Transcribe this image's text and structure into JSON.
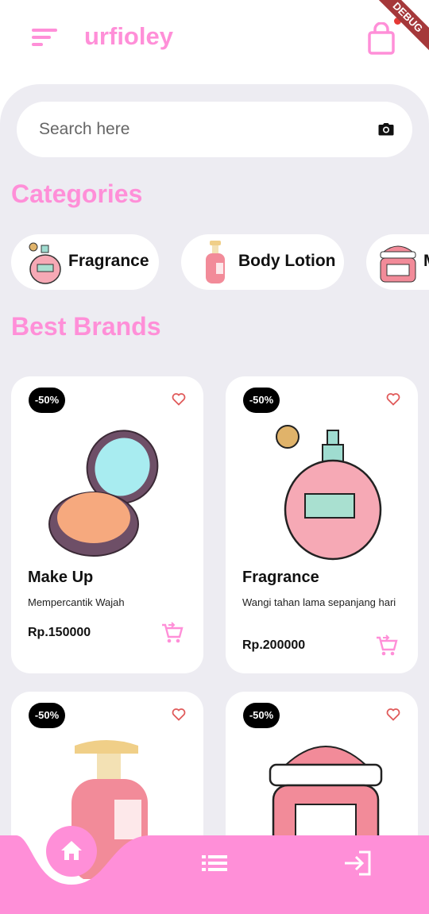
{
  "app": {
    "title": "urfioley",
    "debug_banner": "DEBUG"
  },
  "search": {
    "placeholder": "Search here",
    "icon": "camera-icon"
  },
  "sections": {
    "categories": "Categories",
    "best_brands": "Best Brands"
  },
  "categories": [
    {
      "label": "Fragrance",
      "icon": "perfume-bottle"
    },
    {
      "label": "Body Lotion",
      "icon": "lotion-bottle"
    },
    {
      "label": "M",
      "icon": "cream-jar"
    }
  ],
  "products": [
    {
      "discount": "-50%",
      "name": "Make Up",
      "description": "Mempercantik Wajah",
      "price": "Rp.150000",
      "image": "compact-powder"
    },
    {
      "discount": "-50%",
      "name": "Fragrance",
      "description": "Wangi tahan lama sepanjang hari",
      "price": "Rp.200000",
      "image": "perfume-bottle"
    },
    {
      "discount": "-50%",
      "name": "",
      "description": "",
      "price": "",
      "image": "lotion-bottle"
    },
    {
      "discount": "-50%",
      "name": "",
      "description": "",
      "price": "",
      "image": "cream-jar"
    }
  ],
  "colors": {
    "accent": "#ff8fd8",
    "background": "#edecf2",
    "badge": "#000000",
    "heart": "#e05a5a"
  }
}
